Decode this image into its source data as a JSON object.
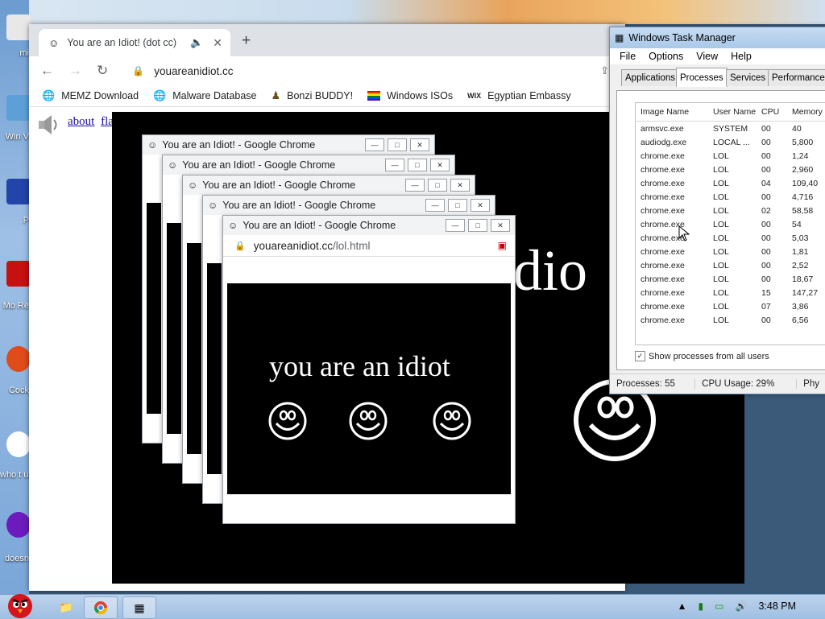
{
  "colors": {
    "tab_bg": "#dee1e6",
    "popup_bar": "#f1f3f4",
    "link": "#1a0dab",
    "tm_title": "#a9c8e9"
  },
  "desktop": {
    "labels": [
      "mi",
      "Win V",
      "P",
      "Mo Re",
      "Cock",
      "who t use",
      "doesn"
    ]
  },
  "chrome": {
    "tab_title": "You are an Idiot! (dot cc)",
    "tab_favicon": "smiley-icon",
    "new_tab": "+",
    "url": "youareanidiot.cc",
    "bookmarks": [
      "MEMZ Download",
      "Malware Database",
      "Bonzi BUDDY!",
      "Windows ISOs",
      "Egyptian Embassy"
    ],
    "links": {
      "about": "about",
      "flash": "flash"
    },
    "big_text": "idio"
  },
  "popup": {
    "title": "You are an Idiot! - Google Chrome",
    "host": "youareanidiot.cc",
    "path": "/lol.html",
    "text": "you are an idiot"
  },
  "task_manager": {
    "title": "Windows Task Manager",
    "menu": [
      "File",
      "Options",
      "View",
      "Help"
    ],
    "tabs": [
      "Applications",
      "Processes",
      "Services",
      "Performance"
    ],
    "columns": [
      "Image Name",
      "User Name",
      "CPU",
      "Memory"
    ],
    "rows": [
      [
        "armsvc.exe",
        "SYSTEM",
        "00",
        "40"
      ],
      [
        "audiodg.exe",
        "LOCAL ...",
        "00",
        "5,800"
      ],
      [
        "chrome.exe",
        "LOL",
        "00",
        "1,24"
      ],
      [
        "chrome.exe",
        "LOL",
        "00",
        "2,960"
      ],
      [
        "chrome.exe",
        "LOL",
        "04",
        "109,40"
      ],
      [
        "chrome.exe",
        "LOL",
        "00",
        "4,716"
      ],
      [
        "chrome.exe",
        "LOL",
        "02",
        "58,58"
      ],
      [
        "chrome.exe",
        "LOL",
        "00",
        "54"
      ],
      [
        "chrome.exe",
        "LOL",
        "00",
        "5,03"
      ],
      [
        "chrome.exe",
        "LOL",
        "00",
        "1,81"
      ],
      [
        "chrome.exe",
        "LOL",
        "00",
        "2,52"
      ],
      [
        "chrome.exe",
        "LOL",
        "00",
        "18,67"
      ],
      [
        "chrome.exe",
        "LOL",
        "15",
        "147,27"
      ],
      [
        "chrome.exe",
        "LOL",
        "07",
        "3,86"
      ],
      [
        "chrome.exe",
        "LOL",
        "00",
        "6,56"
      ]
    ],
    "show_all_label": "Show processes from all users",
    "status_processes": "Processes: 55",
    "status_cpu": "CPU Usage: 29%",
    "status_phys": "Phy"
  },
  "taskbar": {
    "clock": "3:48 PM"
  }
}
